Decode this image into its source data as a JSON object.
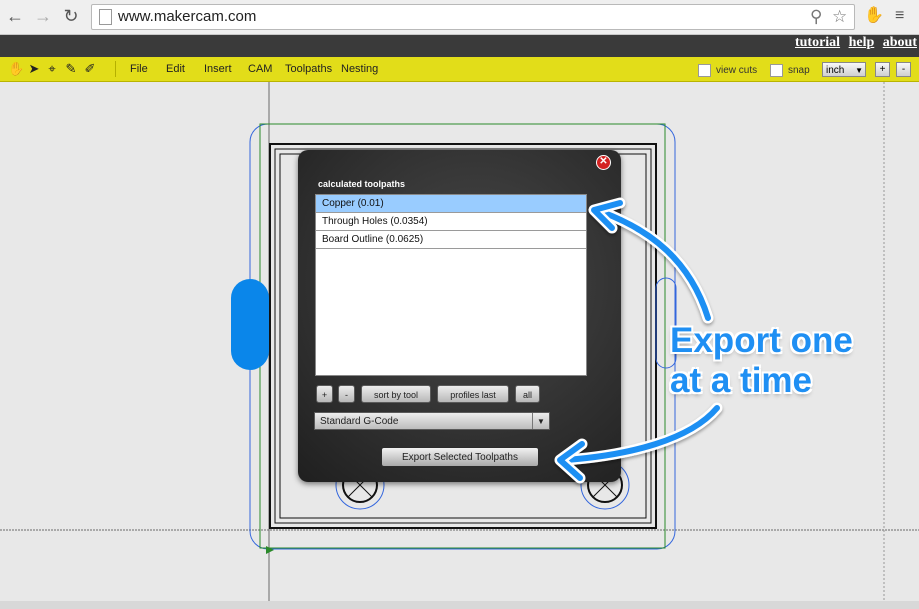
{
  "browser": {
    "back_icon": "back-arrow-icon",
    "forward_icon": "forward-arrow-icon",
    "reload_icon": "reload-icon",
    "url": "www.makercam.com"
  },
  "site_links": {
    "tutorial": "tutorial",
    "help": "help",
    "about": "about"
  },
  "menu": [
    "File",
    "Edit",
    "Insert",
    "CAM",
    "Toolpaths",
    "Nesting"
  ],
  "toolbar": {
    "tools": [
      "hand-icon",
      "arrow-select-icon",
      "node-select-icon",
      "pen-icon",
      "node-edit-icon"
    ],
    "view_cuts_label": "view cuts",
    "snap_label": "snap",
    "unit": "inch",
    "zoom_in": "+",
    "zoom_out": "-"
  },
  "dialog": {
    "title": "calculated toolpaths",
    "toolpaths": [
      "Copper (0.01)",
      "Through Holes (0.0354)",
      "Board Outline (0.0625)"
    ],
    "selected_index": 0,
    "buttons": {
      "add": "+",
      "remove": "-",
      "sort": "sort by tool",
      "profiles": "profiles last",
      "all": "all"
    },
    "format": "Standard G-Code",
    "export_label": "Export Selected Toolpaths"
  },
  "annotation": {
    "line1": "Export one",
    "line2": "at a time",
    "color": "#1f8ff3"
  },
  "colors": {
    "toolbar": "#e2dd19",
    "site_bar": "#3a3a3a",
    "selection": "#99ccff",
    "board_outline": "#2a8a2a",
    "cut_path": "#3366dd"
  }
}
